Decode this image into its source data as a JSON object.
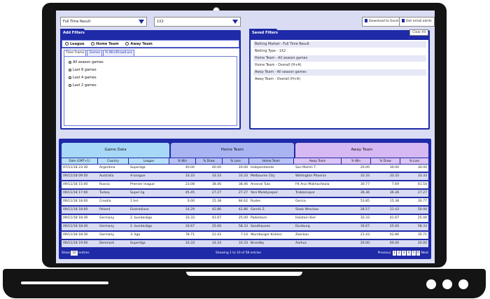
{
  "filters": {
    "market": "Full Time Result",
    "type": "1X2"
  },
  "toolbar": {
    "download": "Download to Excel",
    "alerts": "Get email alerts"
  },
  "add_filters": {
    "title": "Add Filters",
    "radios": [
      "League",
      "Home Team",
      "Away Team"
    ],
    "tabs": [
      "Time Frame",
      "Games",
      "% Win/Draw/Loss"
    ],
    "options": [
      "All season games",
      "Last 8 games",
      "Last 4 games",
      "Last 2 games"
    ]
  },
  "saved_filters": {
    "title": "Saved Filters",
    "clear": "Clear All",
    "items": [
      "Betting Market - Full Time Result",
      "Betting Type - 1X2",
      "Home Team - All season games",
      "Home Team - Overall (H+A)",
      "Away Team - All season games",
      "Away Team - Overall (H+A)"
    ]
  },
  "table": {
    "groups": [
      "Game Data",
      "Home Team",
      "Away Team"
    ],
    "columns": [
      "Date (GMT+1)",
      "Country",
      "League",
      "% Win",
      "% Draw",
      "% Loss",
      "Home Team",
      "Away Team",
      "% Win",
      "% Draw",
      "% Loss"
    ],
    "rows": [
      [
        "07/11/18 23:30",
        "Argentina",
        "Superliga",
        "40.00",
        "40.00",
        "20.00",
        "Independiente",
        "San Martin T.",
        "20.00",
        "30.00",
        "30.00"
      ],
      [
        "09/11/18 09:50",
        "Australia",
        "A-League",
        "33.33",
        "33.33",
        "33.33",
        "Melbourne City",
        "Wellington Phoenix",
        "33.33",
        "33.33",
        "33.33"
      ],
      [
        "09/11/18 15:00",
        "Russia",
        "Premier league",
        "23.08",
        "38.46",
        "38.46",
        "Arsenal Tula",
        "FK Anzi Makhachkala",
        "30.77",
        "7.69",
        "61.54"
      ],
      [
        "09/11/18 17:00",
        "Turkey",
        "Super lig",
        "45.45",
        "27.27",
        "27.27",
        "Yeni Malatyaspor",
        "Trabzonspor",
        "36.36",
        "36.36",
        "27.27"
      ],
      [
        "09/11/18 18:00",
        "Croatia",
        "1 hnl",
        "0.00",
        "15.38",
        "84.62",
        "Rudes",
        "Gorica",
        "53.85",
        "15.38",
        "30.77"
      ],
      [
        "09/11/18 18:00",
        "Poland",
        "Ekstraklasa",
        "14.29",
        "42.86",
        "42.86",
        "Gornik Z.",
        "Slask Wroclaw",
        "28.57",
        "21.43",
        "50.00"
      ],
      [
        "09/11/18 18:30",
        "Germany",
        "2. bundesliga",
        "33.33",
        "41.67",
        "25.00",
        "Paderborn",
        "Holstein Kiel",
        "33.33",
        "41.67",
        "25.00"
      ],
      [
        "09/11/18 18:30",
        "Germany",
        "2. bundesliga",
        "16.67",
        "25.00",
        "58.33",
        "Sandhausen",
        "Duisburg",
        "16.67",
        "25.00",
        "58.33"
      ],
      [
        "09/11/18 18:30",
        "Germany",
        "3. liga",
        "78.71",
        "21.43",
        "7.14",
        "Wurzburger Kickers",
        "Zwickau",
        "21.43",
        "42.86",
        "35.71"
      ],
      [
        "09/11/18 19:00",
        "Denmark",
        "Superliga",
        "33.33",
        "33.33",
        "33.33",
        "Brondby",
        "Aarhus",
        "20.00",
        "60.00",
        "20.00"
      ]
    ]
  },
  "footer": {
    "show": "Show",
    "entries_count": "10",
    "entries": "entries",
    "info": "Showing 1 to 10 of 58 entries",
    "prev": "Previous",
    "pages": [
      "1",
      "2",
      "3",
      "4",
      "5",
      "6"
    ],
    "next": "Next"
  }
}
